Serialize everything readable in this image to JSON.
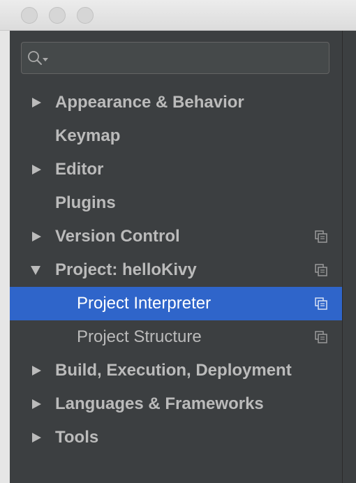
{
  "window": {
    "buttons": [
      "close",
      "minimize",
      "zoom"
    ]
  },
  "search": {
    "placeholder": "",
    "value": ""
  },
  "tree": {
    "items": [
      {
        "label": "Appearance & Behavior",
        "expandable": true,
        "expanded": false,
        "bold": true,
        "project_icon": false
      },
      {
        "label": "Keymap",
        "expandable": false,
        "bold": true,
        "project_icon": false
      },
      {
        "label": "Editor",
        "expandable": true,
        "expanded": false,
        "bold": true,
        "project_icon": false
      },
      {
        "label": "Plugins",
        "expandable": false,
        "bold": true,
        "project_icon": false
      },
      {
        "label": "Version Control",
        "expandable": true,
        "expanded": false,
        "bold": true,
        "project_icon": true
      },
      {
        "label": "Project: helloKivy",
        "expandable": true,
        "expanded": true,
        "bold": true,
        "project_icon": true
      },
      {
        "label": "Project Interpreter",
        "expandable": false,
        "bold": false,
        "project_icon": true,
        "selected": true,
        "child": true
      },
      {
        "label": "Project Structure",
        "expandable": false,
        "bold": false,
        "project_icon": true,
        "child": true
      },
      {
        "label": "Build, Execution, Deployment",
        "expandable": true,
        "expanded": false,
        "bold": true,
        "project_icon": false
      },
      {
        "label": "Languages & Frameworks",
        "expandable": true,
        "expanded": false,
        "bold": true,
        "project_icon": false
      },
      {
        "label": "Tools",
        "expandable": true,
        "expanded": false,
        "bold": true,
        "project_icon": false
      }
    ]
  },
  "colors": {
    "background": "#3c3f41",
    "selection": "#2f65ca",
    "text": "#bbbbbb",
    "selected_text": "#ffffff"
  }
}
